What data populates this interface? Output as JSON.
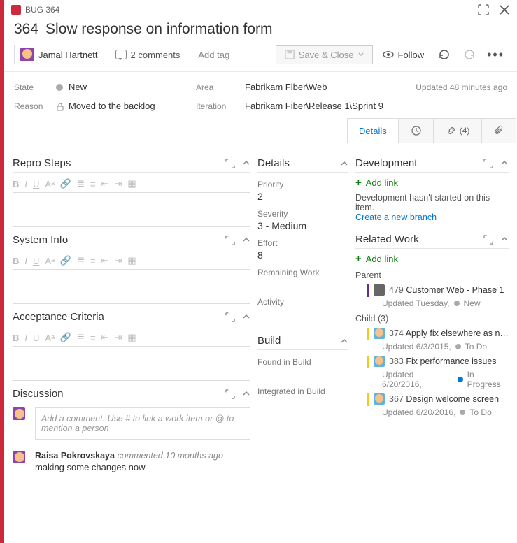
{
  "titlebar": {
    "label": "BUG 364"
  },
  "header": {
    "id": "364",
    "title": "Slow response on information form"
  },
  "toolbar": {
    "assignee": "Jamal Hartnett",
    "comments": "2 comments",
    "add_tag": "Add tag",
    "save_close": "Save & Close",
    "follow": "Follow"
  },
  "meta": {
    "state_label": "State",
    "state_value": "New",
    "reason_label": "Reason",
    "reason_value": "Moved to the backlog",
    "area_label": "Area",
    "area_value": "Fabrikam Fiber\\Web",
    "iteration_label": "Iteration",
    "iteration_value": "Fabrikam Fiber\\Release 1\\Sprint 9",
    "updated": "Updated 48 minutes ago"
  },
  "tabs": {
    "details": "Details",
    "history_icon": "history",
    "links_count": "(4)",
    "attachments_icon": "attachment"
  },
  "left": {
    "repro": "Repro Steps",
    "sysinfo": "System Info",
    "acceptance": "Acceptance Criteria",
    "discussion": "Discussion",
    "disc_placeholder": "Add a comment. Use # to link a work item or @ to mention a person",
    "comment": {
      "author": "Raisa Pokrovskaya",
      "verb": "commented",
      "when": "10 months ago",
      "body": "making some changes now"
    }
  },
  "mid": {
    "details": "Details",
    "priority_l": "Priority",
    "priority_v": "2",
    "severity_l": "Severity",
    "severity_v": "3 - Medium",
    "effort_l": "Effort",
    "effort_v": "8",
    "remaining_l": "Remaining Work",
    "activity_l": "Activity",
    "build": "Build",
    "found_l": "Found in Build",
    "integrated_l": "Integrated in Build"
  },
  "right": {
    "dev_head": "Development",
    "add_link": "Add link",
    "dev_hint": "Development hasn't started on this item.",
    "dev_link": "Create a new branch",
    "rel_head": "Related Work",
    "parent_l": "Parent",
    "parent": {
      "id": "479",
      "title": "Customer Web - Phase 1",
      "sub": "Updated Tuesday,",
      "state": "New"
    },
    "child_l": "Child (3)",
    "children": [
      {
        "id": "374",
        "title": "Apply fix elsewhere as n…",
        "sub": "Updated 6/3/2015,",
        "state": "To Do",
        "dot": ""
      },
      {
        "id": "383",
        "title": "Fix performance issues",
        "sub": "Updated 6/20/2016,",
        "state": "In Progress",
        "dot": "blue"
      },
      {
        "id": "367",
        "title": "Design welcome screen",
        "sub": "Updated 6/20/2016,",
        "state": "To Do",
        "dot": ""
      }
    ]
  }
}
